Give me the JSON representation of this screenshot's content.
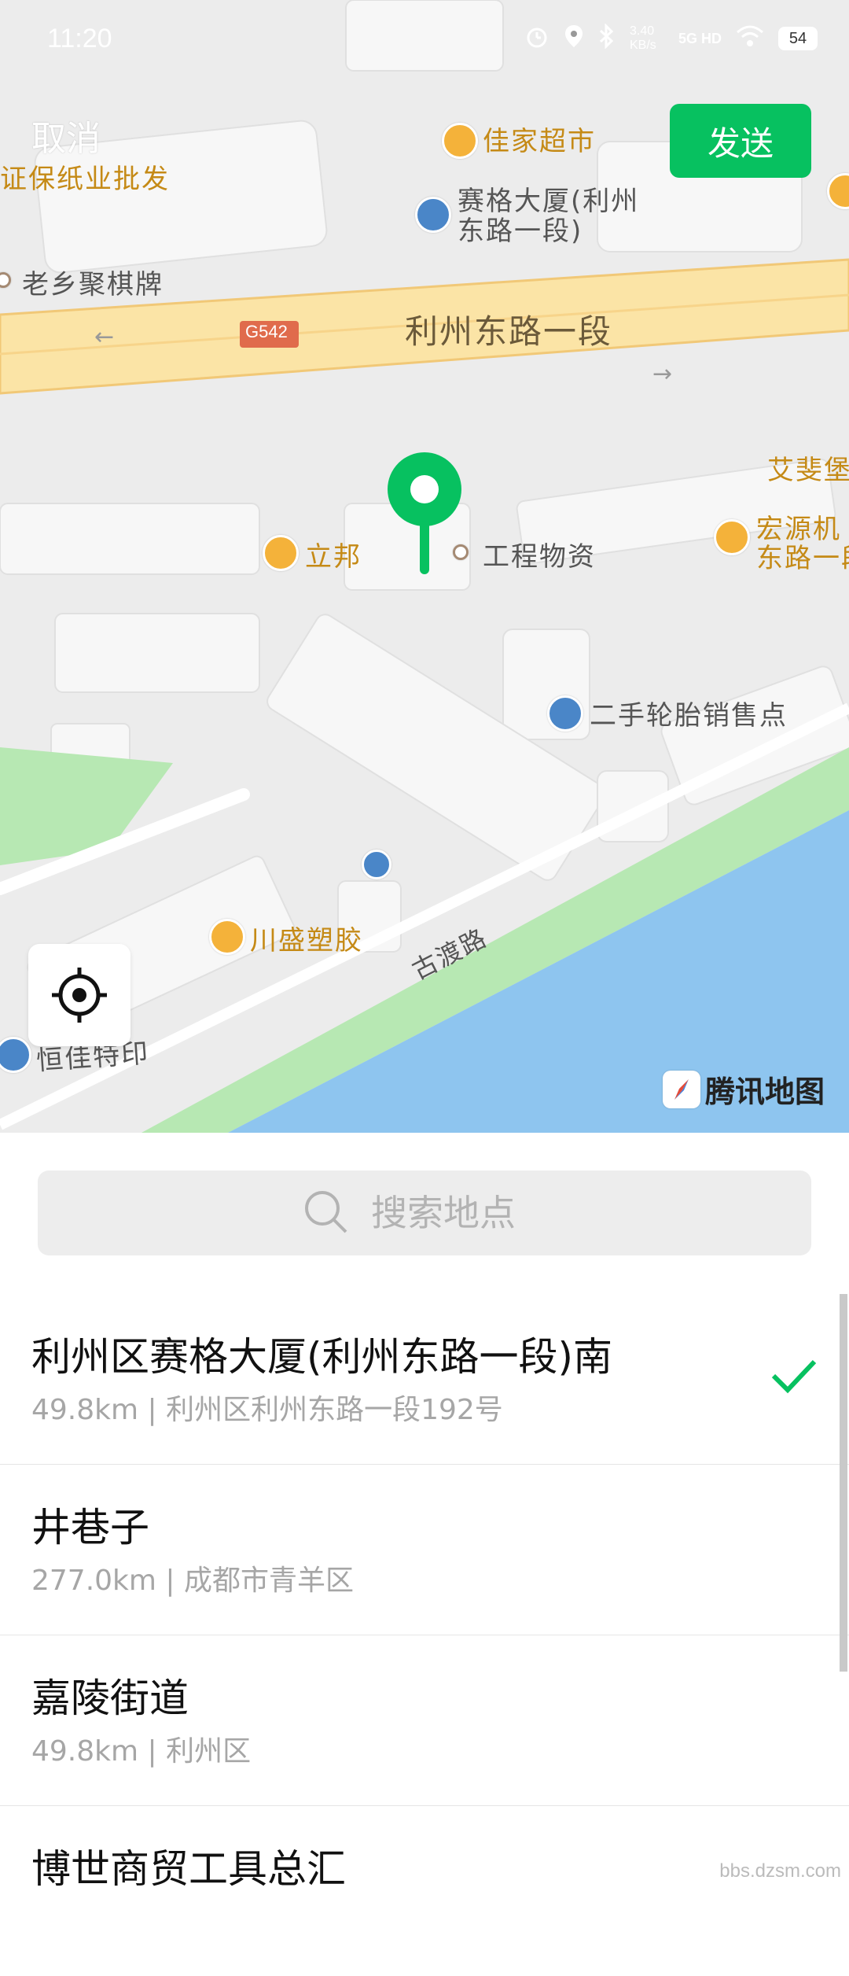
{
  "status_bar": {
    "time": "11:20",
    "speed": "3.40 KB/s",
    "network": "5G HD",
    "battery": "54",
    "icons": [
      "alarm-icon",
      "location-icon",
      "bluetooth-icon",
      "signal-icon",
      "wifi-icon",
      "battery-icon"
    ]
  },
  "header": {
    "cancel_label": "取消",
    "send_label": "发送"
  },
  "map": {
    "labels": {
      "jiajia": "佳家超市",
      "zhengbao": "证保纸业批发",
      "saige": "赛格大厦(利州",
      "saige2": "东路一段)",
      "laoxiang": "老乡聚棋牌",
      "road_badge": "G542",
      "road_main": "利州东路一段",
      "aifei": "艾斐堡",
      "libang": "立邦",
      "gongcheng": "工程物资",
      "hongyuan": "宏源机",
      "hongyuan2": "东路一段",
      "tire": "二手轮胎销售点",
      "chuansheng": "川盛塑胶",
      "gudu": "古渡路",
      "hengjia": "恒佳特印"
    },
    "brand": "腾讯地图"
  },
  "search": {
    "placeholder": "搜索地点"
  },
  "results": [
    {
      "name": "利州区赛格大厦(利州东路一段)南",
      "sub": "49.8km | 利州区利州东路一段192号",
      "selected": true
    },
    {
      "name": "井巷子",
      "sub": "277.0km | 成都市青羊区",
      "selected": false
    },
    {
      "name": "嘉陵街道",
      "sub": "49.8km | 利州区",
      "selected": false
    },
    {
      "name": "博世商贸工具总汇",
      "sub": "",
      "selected": false
    }
  ],
  "watermark": "bbs.dzsm.com",
  "colors": {
    "accent": "#07c160",
    "water": "#8ec5ef",
    "road": "#fbe4a6",
    "green": "#b7e8b3"
  }
}
